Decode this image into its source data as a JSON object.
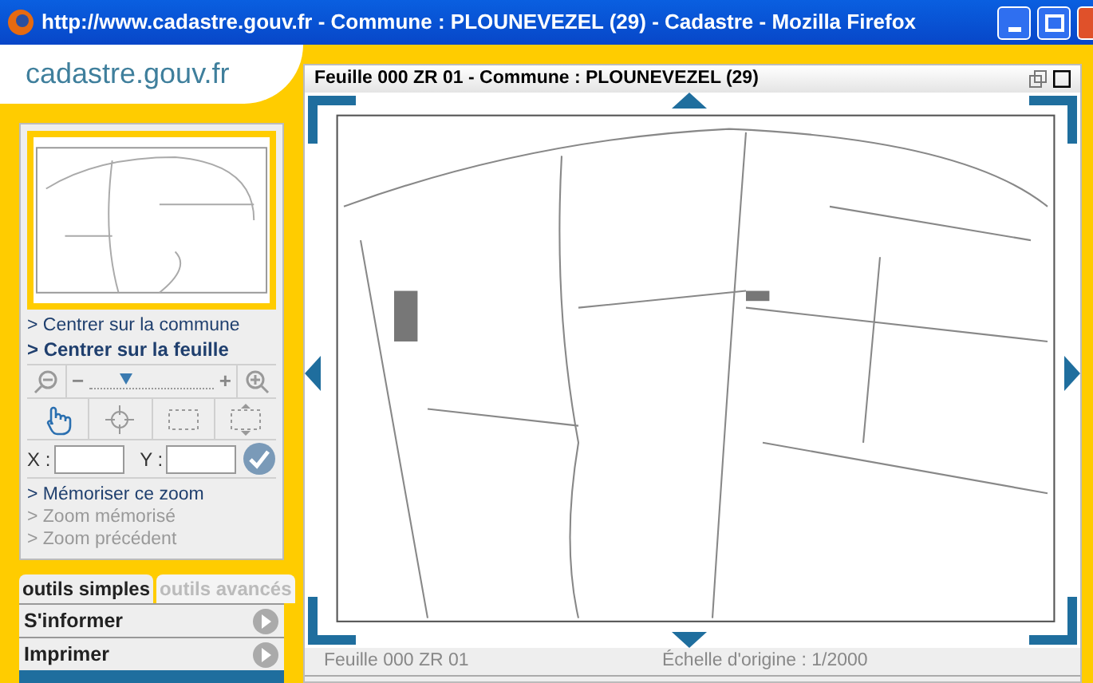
{
  "window": {
    "title": "http://www.cadastre.gouv.fr - Commune : PLOUNEVEZEL (29) - Cadastre - Mozilla Firefox"
  },
  "logo": "cadastre.gouv.fr",
  "nav_links": [
    {
      "label": "> Centrer sur la commune",
      "bold": false
    },
    {
      "label": "> Centrer sur la feuille",
      "bold": true
    }
  ],
  "zoom": {
    "minus": "−",
    "plus": "+",
    "level": 0.3
  },
  "tools": [
    {
      "kind": "pan",
      "selected": true
    },
    {
      "kind": "center",
      "selected": false
    },
    {
      "kind": "box",
      "selected": false
    },
    {
      "kind": "extent",
      "selected": false
    }
  ],
  "coords": {
    "x_label": "X :",
    "y_label": "Y :"
  },
  "zoom_links": [
    {
      "label": "> Mémoriser ce zoom",
      "disabled": false
    },
    {
      "label": "> Zoom mémorisé",
      "disabled": true
    },
    {
      "label": "> Zoom précédent",
      "disabled": true
    }
  ],
  "tabs": [
    {
      "label": "outils simples",
      "selected": true
    },
    {
      "label": "outils avancés",
      "selected": false
    }
  ],
  "menu": [
    "S'informer",
    "Imprimer"
  ],
  "map_window": {
    "title": "Feuille 000 ZR 01 - Commune : PLOUNEVEZEL (29)",
    "status_left": "Feuille 000 ZR 01",
    "status_right": "Échelle d'origine : 1/2000"
  }
}
